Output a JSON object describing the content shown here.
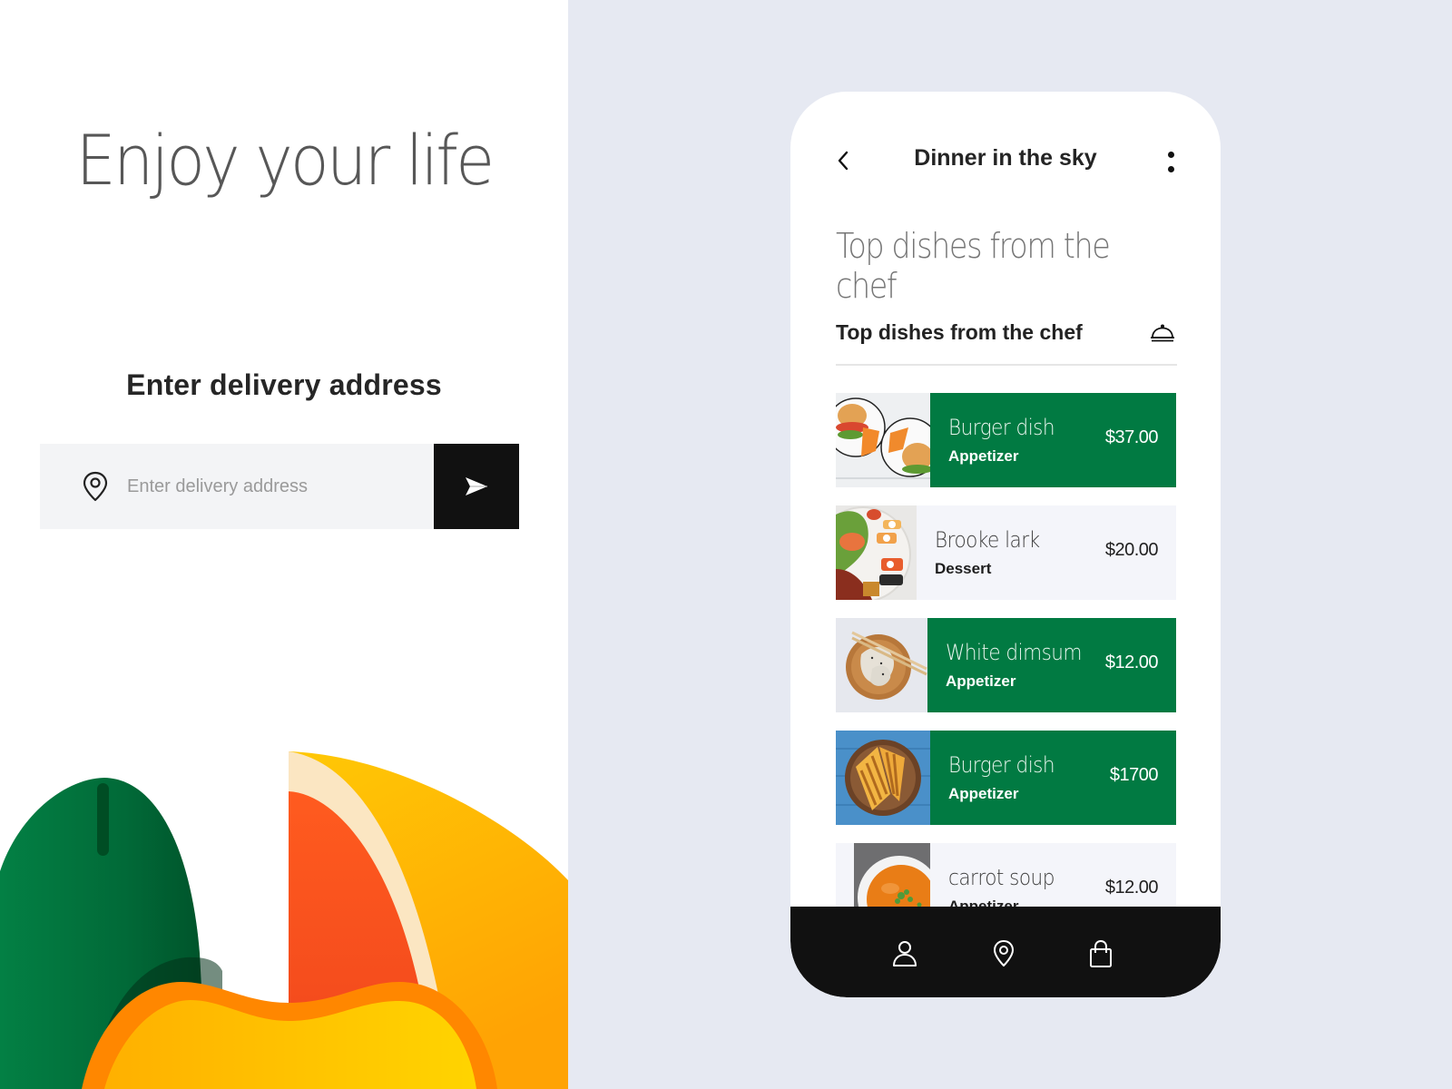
{
  "left": {
    "hero_title": "Enjoy your life",
    "address_heading": "Enter delivery address",
    "address_input": {
      "placeholder": "Enter delivery address",
      "value": ""
    },
    "icons": {
      "pin": "map-pin-icon",
      "send": "send-arrow-icon"
    }
  },
  "phone": {
    "header": {
      "title": "Dinner in the sky",
      "back_icon": "chevron-left-icon",
      "more_icon": "more-vertical-icon"
    },
    "hero_heading": "Top dishes from the chef",
    "section": {
      "label": "Top dishes from the chef",
      "icon": "cloche-icon"
    },
    "dishes": [
      {
        "name": "Burger dish",
        "category": "Appetizer",
        "price": "$37.00",
        "featured": true,
        "image": "burger-plates"
      },
      {
        "name": "Brooke lark",
        "category": "Dessert",
        "price": "$20.00",
        "featured": false,
        "image": "sushi-platter"
      },
      {
        "name": "White dimsum",
        "category": "Appetizer",
        "price": "$12.00",
        "featured": true,
        "image": "dimsum-bowl"
      },
      {
        "name": "Burger dish",
        "category": "Appetizer",
        "price": "$1700",
        "featured": true,
        "image": "grilled-sandwich"
      },
      {
        "name": "carrot soup",
        "category": "Appetizer",
        "price": "$12.00",
        "featured": false,
        "image": "carrot-soup"
      }
    ],
    "bottom_nav": [
      {
        "icon": "profile-icon",
        "label": "Profile"
      },
      {
        "icon": "location-icon",
        "label": "Location"
      },
      {
        "icon": "shopping-bag-icon",
        "label": "Bag"
      }
    ]
  },
  "colors": {
    "brand_green": "#017a42",
    "item_gray": "#f4f5fa",
    "page_bg": "#e6e9f2",
    "dark": "#111111"
  }
}
